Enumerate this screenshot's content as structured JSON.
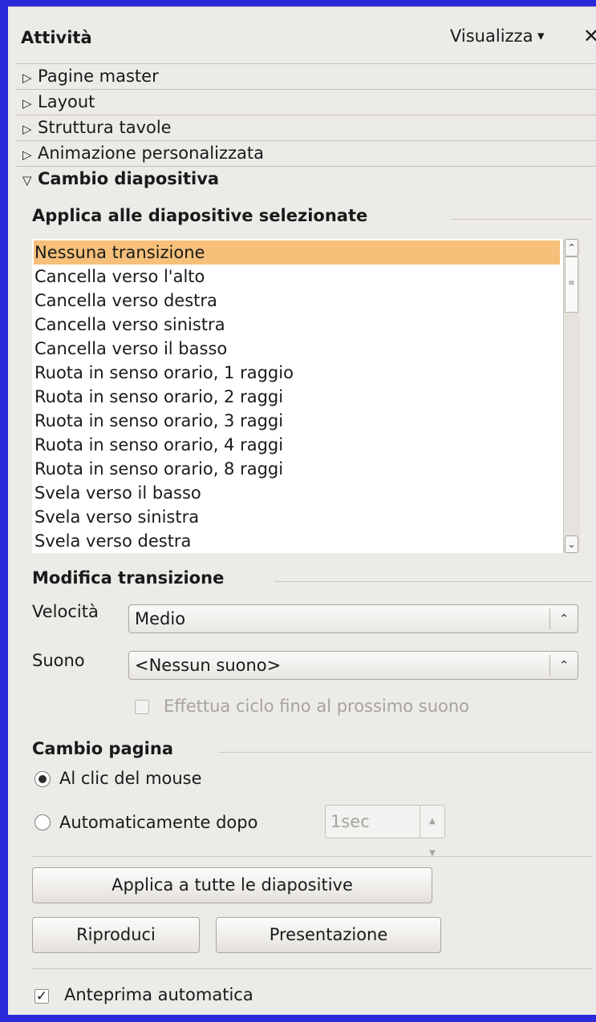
{
  "header": {
    "title": "Attività",
    "view_label": "Visualizza",
    "view_arrow": "▾",
    "close_glyph": "✕"
  },
  "decks": [
    {
      "label": "Pagine master",
      "open": false
    },
    {
      "label": "Layout",
      "open": false
    },
    {
      "label": "Struttura tavole",
      "open": false
    },
    {
      "label": "Animazione personalizzata",
      "open": false
    },
    {
      "label": "Cambio diapositiva",
      "open": true
    }
  ],
  "icons": {
    "deck_closed": "▷",
    "deck_open": "▽"
  },
  "transition": {
    "heading": "Applica alle diapositive selezionate",
    "items": [
      "Nessuna transizione",
      "Cancella verso l'alto",
      "Cancella verso destra",
      "Cancella verso sinistra",
      "Cancella verso il basso",
      "Ruota in senso orario, 1 raggio",
      "Ruota in senso orario, 2 raggi",
      "Ruota in senso orario, 3 raggi",
      "Ruota in senso orario, 4 raggi",
      "Ruota in senso orario, 8 raggi",
      "Svela verso il basso",
      "Svela verso sinistra",
      "Svela verso destra"
    ],
    "selected_index": 0,
    "selected_color": "#f6c07a"
  },
  "modify": {
    "heading": "Modifica transizione",
    "speed_label": "Velocità",
    "speed_value": "Medio",
    "sound_label": "Suono",
    "sound_value": "<Nessun suono>",
    "loop_label": "Effettua ciclo fino al prossimo suono",
    "loop_checked": false,
    "loop_enabled": false
  },
  "advance": {
    "heading": "Cambio pagina",
    "on_click_label": "Al clic del mouse",
    "auto_label": "Automaticamente dopo",
    "auto_value": "1sec",
    "selected": "on_click"
  },
  "buttons": {
    "apply_all": "Applica a tutte le diapositive",
    "play": "Riproduci",
    "slideshow": "Presentazione"
  },
  "preview": {
    "label": "Anteprima automatica",
    "checked": true
  }
}
